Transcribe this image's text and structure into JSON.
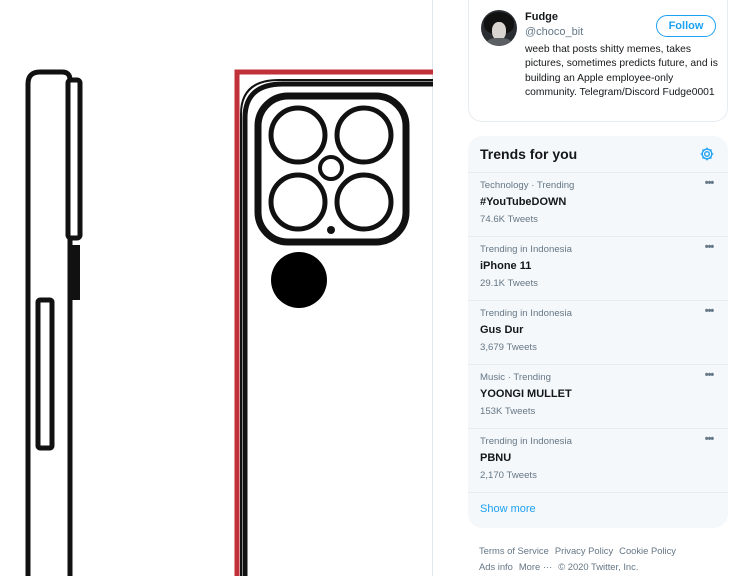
{
  "profile": {
    "name": "Fudge",
    "handle": "@choco_bit",
    "follow_label": "Follow",
    "bio": "weeb that posts shitty memes, takes pictures, sometimes predicts future, and is building an Apple employee-only community. Telegram/Discord Fudge0001"
  },
  "trends": {
    "title": "Trends for you",
    "settings_icon": "gear-icon",
    "more_icon": "ellipsis-icon",
    "items": [
      {
        "meta": "Technology · Trending",
        "name": "#YouTubeDOWN",
        "count": "74.6K Tweets"
      },
      {
        "meta": "Trending in Indonesia",
        "name": "iPhone 11",
        "count": "29.1K Tweets"
      },
      {
        "meta": "Trending in Indonesia",
        "name": "Gus Dur",
        "count": "3,679 Tweets"
      },
      {
        "meta": "Music · Trending",
        "name": "YOONGI MULLET",
        "count": "153K Tweets"
      },
      {
        "meta": "Trending in Indonesia",
        "name": "PBNU",
        "count": "2,170 Tweets"
      }
    ],
    "show_more": "Show more"
  },
  "footer": {
    "terms": "Terms of Service",
    "privacy": "Privacy Policy",
    "cookie": "Cookie Policy",
    "ads": "Ads info",
    "more": "More ···",
    "copyright": "© 2020 Twitter, Inc."
  },
  "colors": {
    "accent": "#1da1f2",
    "secondary_text": "#657786",
    "card_bg": "#f5f8fa",
    "phone_highlight": "#c0313a"
  }
}
